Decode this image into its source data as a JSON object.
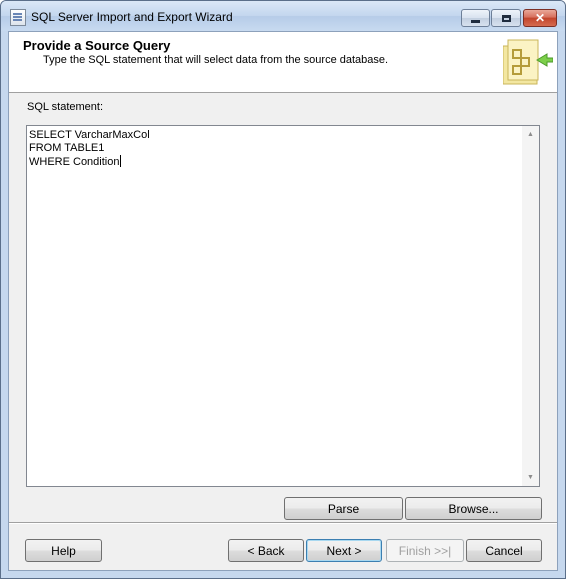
{
  "window": {
    "title": "SQL Server Import and Export Wizard",
    "close_glyph": "✕"
  },
  "header": {
    "title": "Provide a Source Query",
    "subtitle": "Type the SQL statement that will select data from the source database."
  },
  "sql": {
    "label": "SQL statement:",
    "lines": [
      "SELECT VarcharMaxCol",
      "FROM TABLE1",
      "WHERE Condition"
    ],
    "scroll_up_glyph": "▲",
    "scroll_down_glyph": "▼"
  },
  "buttons": {
    "parse": "Parse",
    "browse": "Browse...",
    "help": "Help",
    "back": "< Back",
    "next": "Next >",
    "finish": "Finish >>|",
    "cancel": "Cancel"
  },
  "icons": {
    "app": "wizard-app-icon",
    "header_graphic": "database-export-icon"
  }
}
